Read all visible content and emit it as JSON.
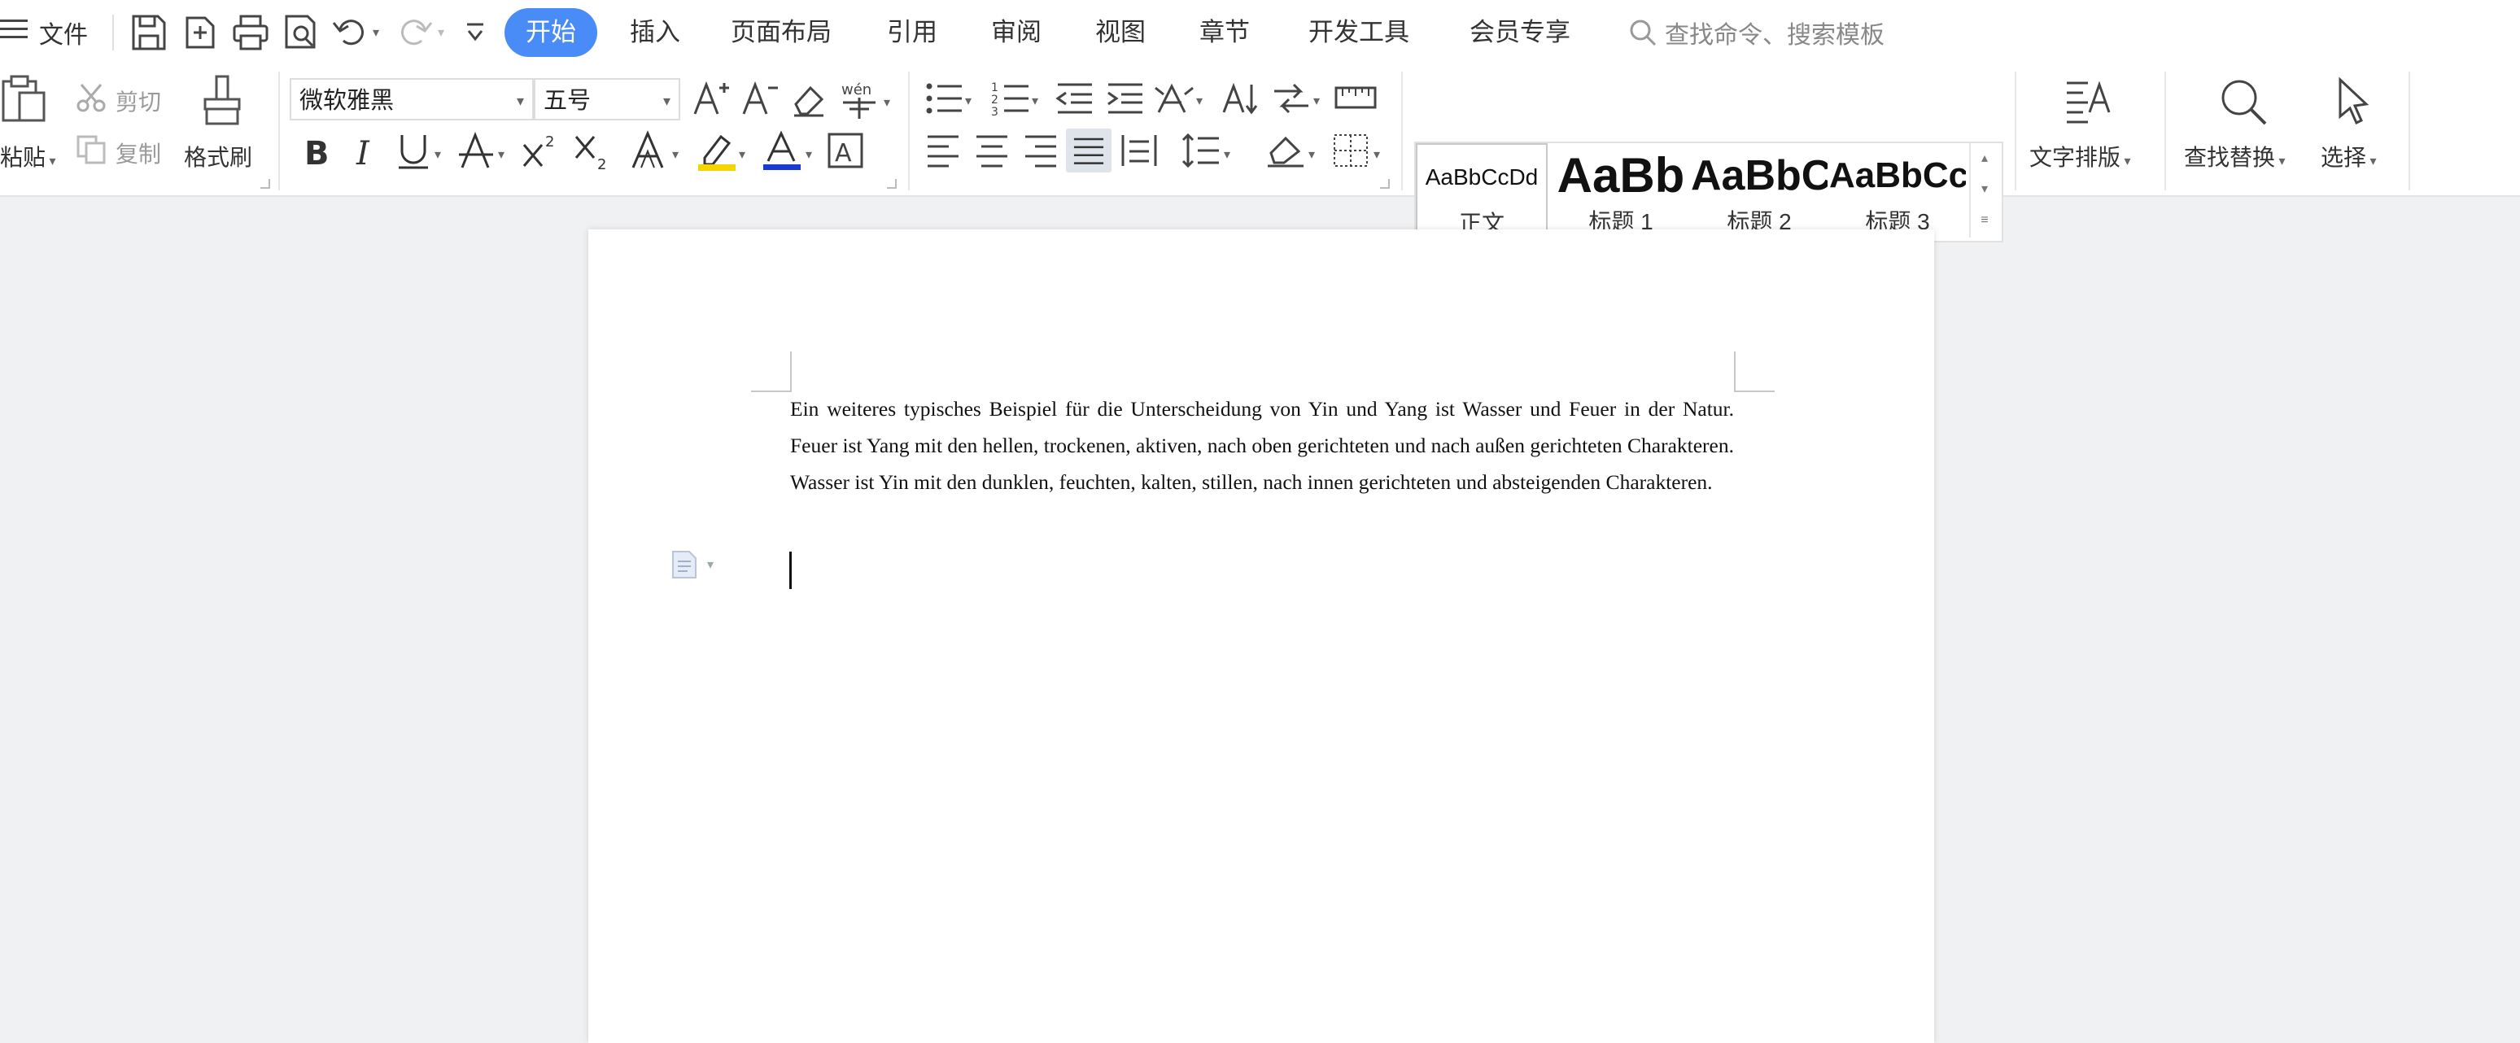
{
  "menu": {
    "file_label": "文件",
    "tabs": [
      "开始",
      "插入",
      "页面布局",
      "引用",
      "审阅",
      "视图",
      "章节",
      "开发工具",
      "会员专享"
    ],
    "active_tab": "开始",
    "search_placeholder": "查找命令、搜索模板"
  },
  "ribbon": {
    "clipboard": {
      "paste_label": "粘贴",
      "cut_label": "剪切",
      "copy_label": "复制",
      "format_painter_label": "格式刷"
    },
    "font": {
      "font_name": "微软雅黑",
      "font_size": "五号",
      "text_preview": "A",
      "phonetic": "wén"
    },
    "styles": [
      {
        "preview": "AaBbCcDd",
        "name": "正文"
      },
      {
        "preview": "AaBb",
        "name": "标题 1"
      },
      {
        "preview": "AaBbC",
        "name": "标题 2"
      },
      {
        "preview": "AaBbCc",
        "name": "标题 3"
      }
    ],
    "text_layout_label": "文字排版",
    "find_replace_label": "查找替换",
    "select_label": "选择"
  },
  "document": {
    "paragraph": "Ein weiteres typisches Beispiel für die Unterscheidung von Yin und Yang ist Wasser und Feuer in der Natur. Feuer ist Yang mit den hellen, trockenen, aktiven, nach oben gerichteten und nach außen gerichteten Charakteren. Wasser ist Yin mit den dunklen, feuchten, kalten, stillen, nach innen gerichteten und absteigenden Charakteren."
  },
  "colors": {
    "accent": "#4a8cf7",
    "highlight": "#f5d400",
    "font_color": "#1a3bd1"
  }
}
